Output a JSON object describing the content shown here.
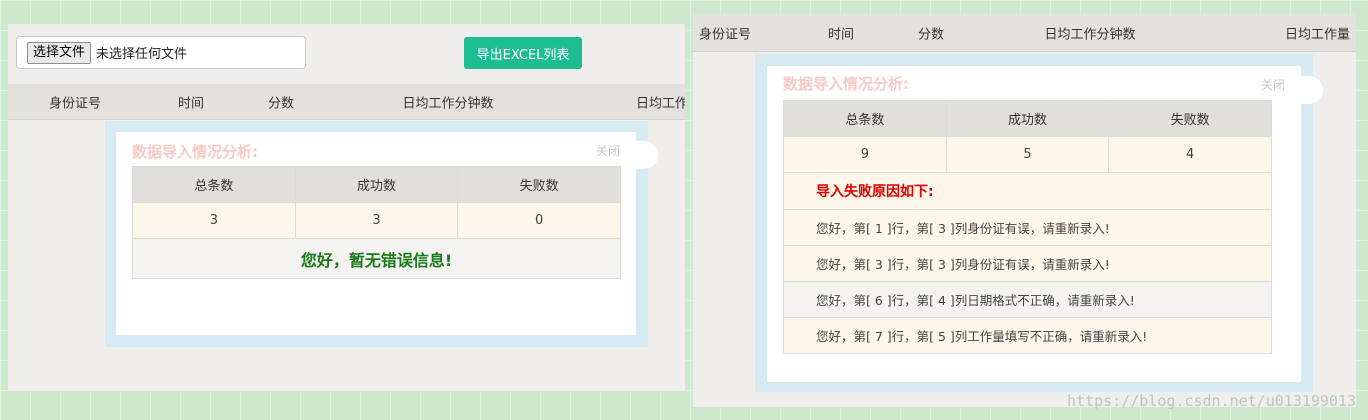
{
  "left": {
    "file_input": {
      "button_label": "选择文件",
      "status": "未选择任何文件"
    },
    "export_button": "导出EXCEL列表",
    "columns": [
      "身份证号",
      "时间",
      "分数",
      "日均工作分钟数",
      "日均工作"
    ],
    "dialog": {
      "title": "数据导入情况分析:",
      "close": "关闭",
      "headers": [
        "总条数",
        "成功数",
        "失败数"
      ],
      "values": [
        "3",
        "3",
        "0"
      ],
      "message": "您好，暂无错误信息!"
    }
  },
  "right": {
    "columns": [
      "身份证号",
      "时间",
      "分数",
      "日均工作分钟数",
      "日均工作量"
    ],
    "dialog": {
      "title": "数据导入情况分析:",
      "close": "关闭",
      "headers": [
        "总条数",
        "成功数",
        "失败数"
      ],
      "values": [
        "9",
        "5",
        "4"
      ],
      "reason_title": "导入失败原因如下:",
      "errors": [
        "您好，第[ 1 ]行，第[ 3 ]列身份证有误，请重新录入!",
        "您好，第[ 3 ]行，第[ 3 ]列身份证有误，请重新录入!",
        "您好，第[ 6 ]行，第[ 4 ]列日期格式不正确，请重新录入!",
        "您好，第[ 7 ]行，第[ 5 ]列工作量填写不正确，请重新录入!"
      ]
    }
  },
  "watermark": "https://blog.csdn.net/u013199013"
}
